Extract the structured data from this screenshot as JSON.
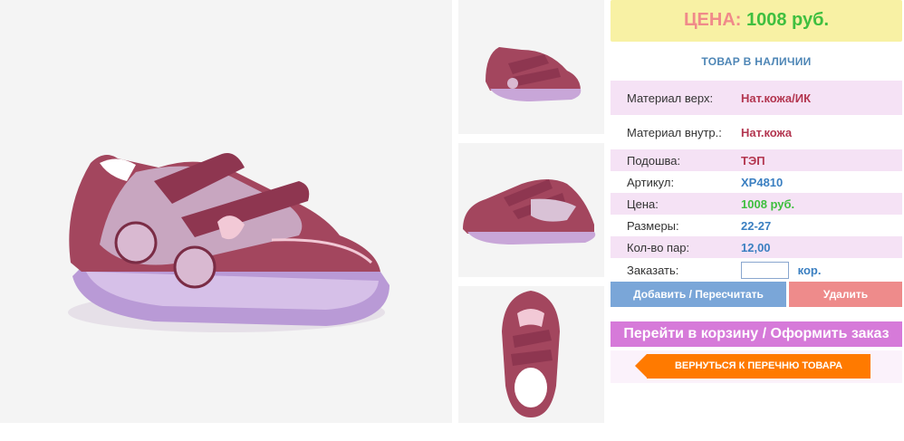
{
  "price_box": {
    "label": "ЦЕНА:",
    "value": "1008 руб."
  },
  "stock_status": "ТОВАР В НАЛИЧИИ",
  "specs": [
    {
      "label": "Материал верх:",
      "value": "Нат.кожа/ИК"
    },
    {
      "label": "Материал внутр.:",
      "value": "Нат.кожа"
    },
    {
      "label": "Подошва:",
      "value": "ТЭП"
    },
    {
      "label": "Артикул:",
      "value": "XP4810"
    },
    {
      "label": "Цена:",
      "value": "1008 руб."
    },
    {
      "label": "Размеры:",
      "value": "22-27"
    },
    {
      "label": "Кол-во пар:",
      "value": "12,00"
    },
    {
      "label": "Заказать:",
      "value": "",
      "unit": "кор."
    }
  ],
  "buttons": {
    "add": "Добавить / Пересчитать",
    "delete": "Удалить",
    "cart": "Перейти в корзину / Оформить заказ",
    "back": "ВЕРНУТЬСЯ К ПЕРЕЧНЮ ТОВАРА"
  },
  "images": {
    "main": "sneaker-side-view",
    "thumbs": [
      "sneaker-side-view",
      "sneaker-inner-side-view",
      "sneaker-top-view"
    ]
  },
  "colors": {
    "price_bg": "#f8f1a4",
    "price_label": "#f08a8a",
    "price_value": "#3fbf3f",
    "row_highlight": "#f5e2f5",
    "add_button": "#7aa6d8",
    "delete_button": "#ee8b8b",
    "cart_button": "#d67ad9",
    "back_button": "#ff7a00"
  }
}
